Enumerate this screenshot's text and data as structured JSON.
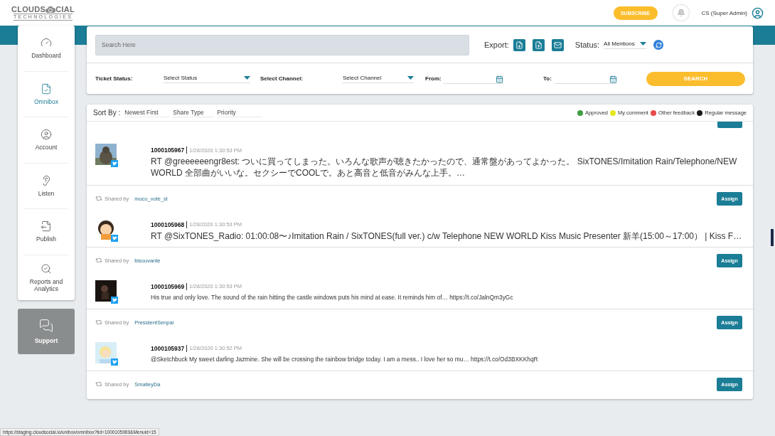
{
  "header": {
    "logo": {
      "left": "CLOUDS",
      "right": "CIAL",
      "bottom": "TECHNOLOGIES"
    },
    "subscribe": "SUBSCRIBE",
    "user": "CS (Super Admin)"
  },
  "sidebar": {
    "items": [
      {
        "label": "Dashboard",
        "selected": false
      },
      {
        "label": "Omnibox",
        "selected": true
      },
      {
        "label": "Account",
        "selected": false
      },
      {
        "label": "Listen",
        "selected": false
      },
      {
        "label": "Publish",
        "selected": false
      },
      {
        "label": "Reports and Analytics",
        "selected": false
      }
    ],
    "support": "Support"
  },
  "filters": {
    "search": {
      "placeholder": "Search Here"
    },
    "export_label": "Export:",
    "status_label": "Status:",
    "status_value": "All Mentions",
    "ticket_status": {
      "label": "Ticket Status:",
      "value": "Select Status"
    },
    "channel": {
      "label": "Select Channel:",
      "value": "Select Channel"
    },
    "from_label": "From:",
    "to_label": "To:",
    "search_button": "SEARCH"
  },
  "sort": {
    "label": "Sort By :",
    "options": [
      "Newest First",
      "Share Type",
      "Priority"
    ]
  },
  "legend": [
    {
      "label": "Approved",
      "color": "#3f9e3f"
    },
    {
      "label": "My comment",
      "color": "#e6e61e"
    },
    {
      "label": "Other feedback",
      "color": "#e84a4a"
    },
    {
      "label": "Regular message",
      "color": "#1a1a1a"
    }
  ],
  "posts": [
    {
      "kind": "top_cut",
      "id": "1000105967",
      "date": "1/28/2020 1:30:53 PM",
      "text": "RT @greeeeeengr8est: ついに買ってしまった。いろんな歌声が聴きたかったので、通常盤があってよかった。 SixTONES/Imitation Rain/Telephone/NEW WORLD 全部曲がいいな。セクシーでCOOLで。あと高音と低音がみんな上手。…"
    },
    {
      "kind": "full",
      "shared_label": "Shared by",
      "shared_by": "moco_vote_st",
      "assign": "Assign",
      "id": "1000105968",
      "date": "1/28/2020 1:30:53 PM",
      "text": "RT @SixTONES_Radio: 01:00:08〜♪Imitation Rain / SixTONES(full ver.) c/w Telephone NEW WORLD Kiss Music Presenter 新羊(15:00～17:00） | Kiss F…"
    },
    {
      "kind": "full",
      "shared_label": "Shared by",
      "shared_by": "bisouvante",
      "assign": "Assign",
      "id": "1000105969",
      "date": "1/28/2020 1:30:53 PM",
      "text": "His true and only love. The sound of the rain hitting the castle windows puts his mind at ease. It reminds him of… https://t.co/JalnQm3yGc"
    },
    {
      "kind": "full",
      "shared_label": "Shared by",
      "shared_by": "PresidentSenpai",
      "assign": "Assign",
      "id": "1000105937",
      "date": "1/28/2020 1:30:52 PM",
      "text": "@Sketchbuck My sweet darling Jazmine. She will be crossing the rainbow bridge today. I am a mess.. I love her so mu… https://t.co/Od3BXKKhqR"
    },
    {
      "kind": "bottom_cut",
      "shared_label": "Shared by",
      "shared_by": "SmalleyDa",
      "assign": "Assign"
    }
  ],
  "status_url": "https://staging.cloudsocial.io/unibox/omnibox?tid=1000105969&Menuid=15"
}
